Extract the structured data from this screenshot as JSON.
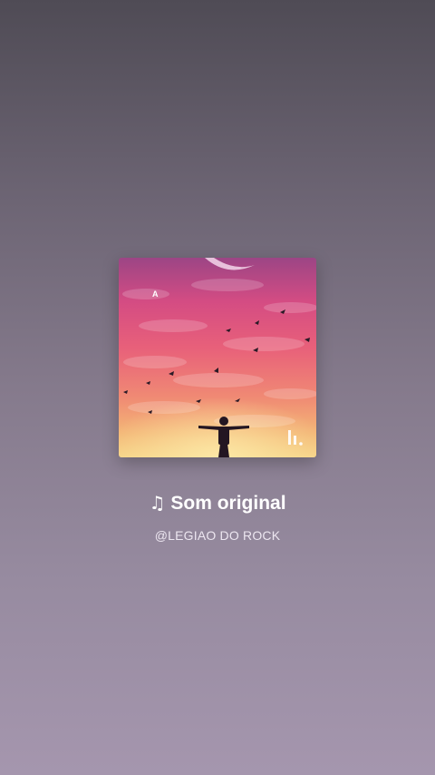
{
  "audio": {
    "note_icon": "music-note-icon",
    "title": "Som original",
    "author": "@LEGIAO DO ROCK"
  },
  "cover": {
    "corner_letter": "A",
    "sky_top_color": "#a4457f",
    "sky_bottom_color": "#f2c27a"
  }
}
